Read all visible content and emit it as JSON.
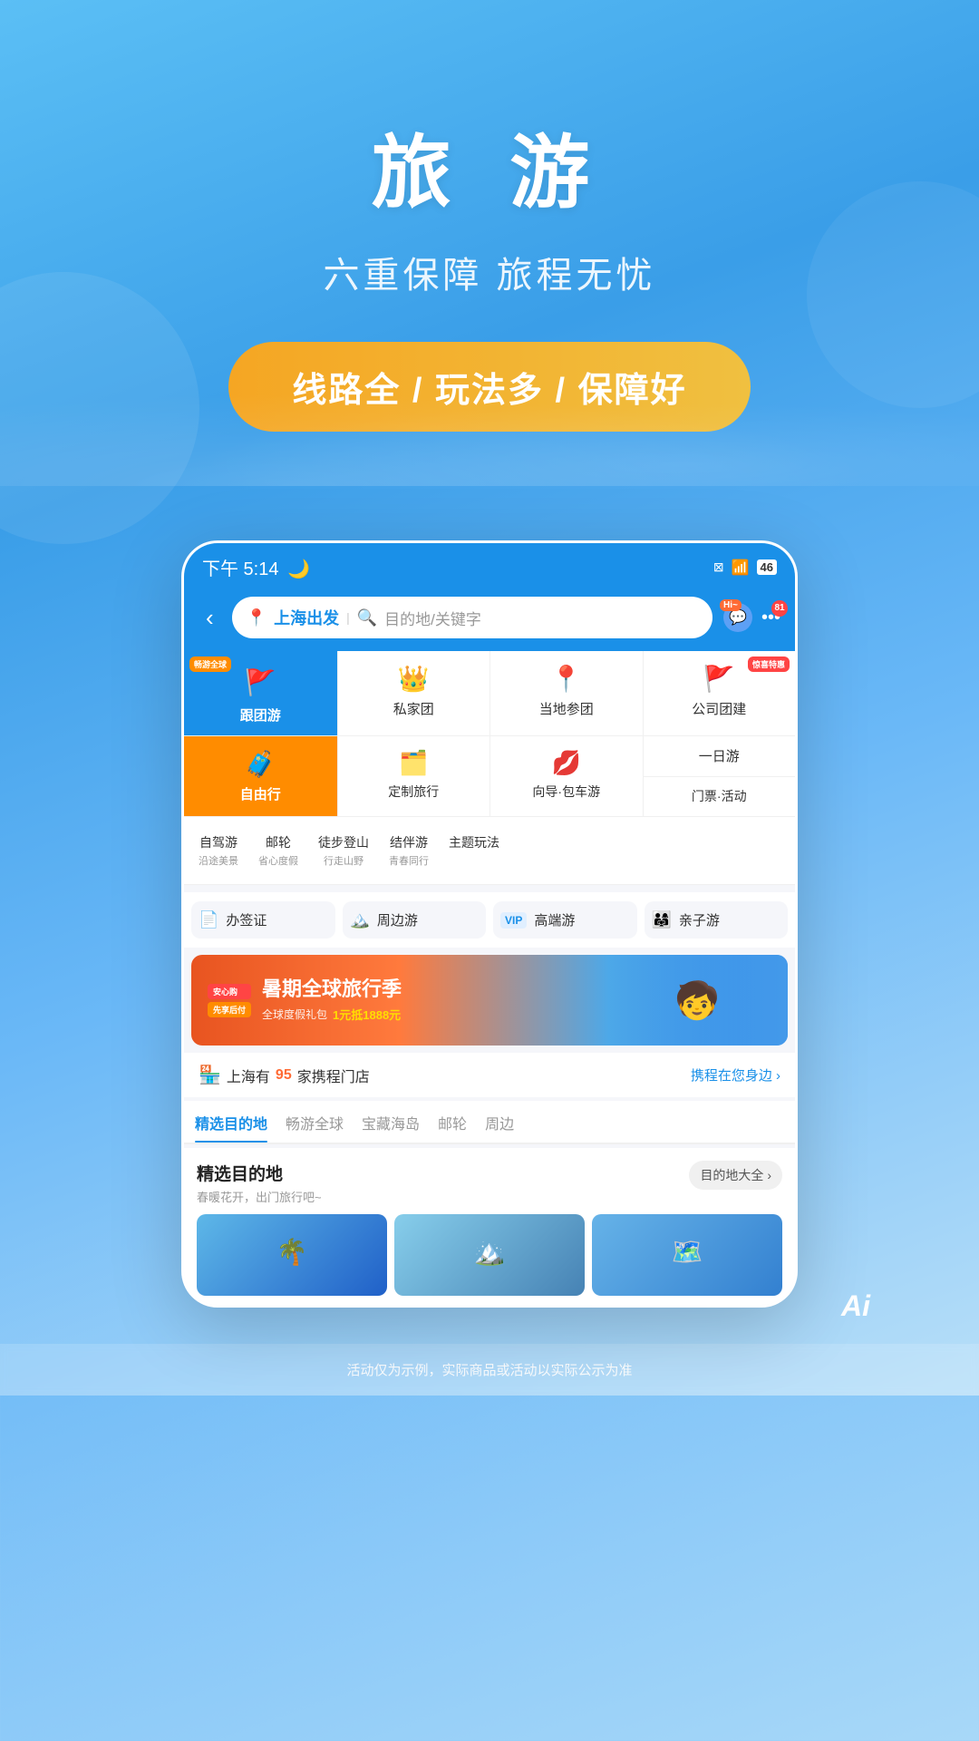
{
  "hero": {
    "title": "旅 游",
    "subtitle": "六重保障 旅程无忧",
    "badge": "线路全 / 玩法多 / 保障好"
  },
  "statusBar": {
    "time": "下午 5:14",
    "moonIcon": "🌙"
  },
  "searchBar": {
    "fromCity": "上海出发",
    "placeholder": "目的地/关键字",
    "backLabel": "‹",
    "hiBadge": "Hi~",
    "notifCount": "81"
  },
  "menu": {
    "row1": [
      {
        "id": "group-tour",
        "label": "跟团游",
        "sublabel": "畅游全球",
        "badge": "畅游全球",
        "bg": "blue"
      },
      {
        "id": "private-tour",
        "label": "私家团",
        "sublabel": "",
        "badge": ""
      },
      {
        "id": "local-tour",
        "label": "当地参团",
        "sublabel": "",
        "badge": ""
      },
      {
        "id": "corp-tour",
        "label": "公司团建",
        "sublabel": "",
        "badge": "惊喜特惠"
      }
    ],
    "row2": [
      {
        "id": "free-travel",
        "label": "自由行",
        "sublabel": "",
        "bg": "orange"
      },
      {
        "id": "custom-travel",
        "label": "定制旅行",
        "sublabel": ""
      },
      {
        "id": "guide-tour",
        "label": "向导·包车游",
        "sublabel": ""
      }
    ],
    "row2right": [
      {
        "id": "day-tour",
        "label": "一日游"
      },
      {
        "id": "tickets",
        "label": "门票·活动"
      }
    ],
    "row3": [
      {
        "id": "drive-tour",
        "label": "自驾游",
        "sub": "沿途美景"
      },
      {
        "id": "cruise",
        "label": "邮轮",
        "sub": "省心度假"
      },
      {
        "id": "hiking",
        "label": "徒步登山",
        "sub": "行走山野"
      },
      {
        "id": "partner-tour",
        "label": "结伴游",
        "sub": "青春同行"
      },
      {
        "id": "theme-play",
        "label": "主题玩法",
        "sub": ""
      }
    ]
  },
  "quickLinks": [
    {
      "id": "visa",
      "label": "办签证",
      "icon": "📄"
    },
    {
      "id": "nearby",
      "label": "周边游",
      "icon": "🏔️"
    },
    {
      "id": "luxury",
      "label": "高端游",
      "icon": "VIP",
      "isVip": true
    },
    {
      "id": "family",
      "label": "亲子游",
      "icon": "👨‍👩‍👧"
    }
  ],
  "banner": {
    "title": "暑期全球旅行季",
    "subtitle": "全球度假礼包",
    "highlight": "1元抵1888元"
  },
  "storeInfo": {
    "prefix": "上海有",
    "count": "95",
    "suffix": "家携程门店",
    "link": "携程在您身边 ›"
  },
  "tabs": [
    {
      "id": "selected",
      "label": "精选目的地",
      "active": true
    },
    {
      "id": "global",
      "label": "畅游全球"
    },
    {
      "id": "island",
      "label": "宝藏海岛"
    },
    {
      "id": "cruise",
      "label": "邮轮"
    },
    {
      "id": "nearby",
      "label": "周边"
    }
  ],
  "destSection": {
    "title": "精选目的地",
    "subtitle": "春暖花开，出门旅行吧~",
    "allBtn": "目的地大全 ›"
  },
  "disclaimer": "活动仅为示例，实际商品或活动以实际公示为准",
  "aiLabel": "Ai"
}
